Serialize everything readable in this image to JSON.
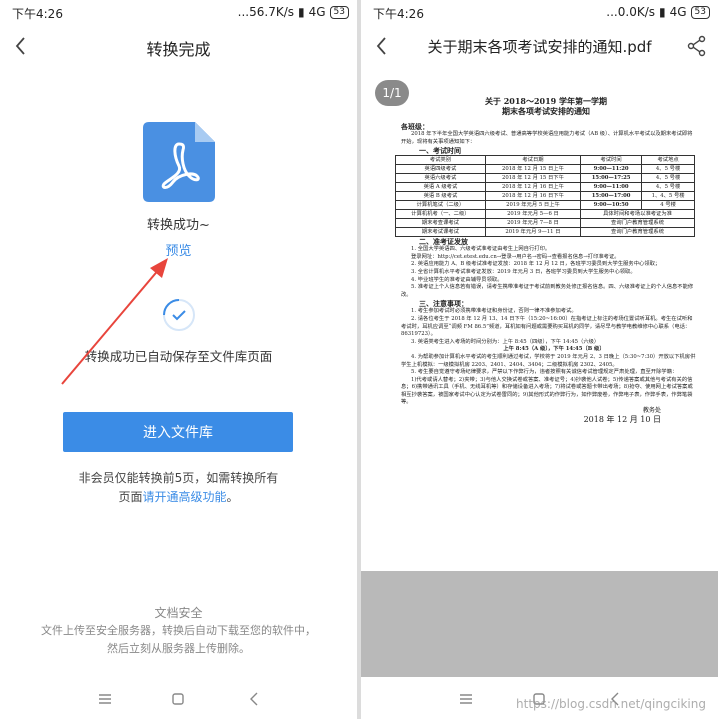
{
  "left": {
    "status": {
      "time": "下午4:26",
      "network": "...56.7K/s",
      "signal": "4G",
      "battery": "53"
    },
    "title": "转换完成",
    "success": "转换成功~",
    "preview": "预览",
    "saved": "转换成功已自动保存至文件库页面",
    "enter_button": "进入文件库",
    "member_line1": "非会员仅能转换前5页，如需转换所有",
    "member_line2_prefix": "页面",
    "member_link": "请开通高级功能",
    "member_line2_suffix": "。",
    "security_title": "文档安全",
    "security_line1": "文件上传至安全服务器，转换后自动下载至您的软件中，",
    "security_line2": "然后立刻从服务器上传删除。"
  },
  "right": {
    "status": {
      "time": "下午4:26",
      "network": "...0.0K/s",
      "signal": "4G",
      "battery": "53"
    },
    "title": "关于期末各项考试安排的通知.pdf",
    "page_indicator": "1/1",
    "watermark": "https://blog.csdn.net/qingciking",
    "doc": {
      "title1": "关于 2018～2019 学年第一学期",
      "title2": "期末各项考试安排的通知",
      "greeting": "各班级：",
      "intro": "2018 年下半年全国大学英语四六级考试、普通高等学校英语应用能力考试（AB 级）、计算机水平考试以及期末考试即将开始，现将有关事项通知如下：",
      "sec1": "一、考试时间",
      "table_headers": [
        "考试类别",
        "考试日期",
        "考试时间",
        "考试地点"
      ],
      "table_rows": [
        [
          "英语四级考试",
          "2018 年 12 月 15 日上午",
          "9:00—11:20",
          "4、5 号楼"
        ],
        [
          "英语六级考试",
          "2018 年 12 月 15 日下午",
          "15:00—17:25",
          "4、5 号楼"
        ],
        [
          "英语 A 级考试",
          "2018 年 12 月 16 日上午",
          "9:00—11:00",
          "4、5 号楼"
        ],
        [
          "英语 B 级考试",
          "2018 年 12 月 16 日下午",
          "15:00—17:00",
          "1、4、5 号楼"
        ],
        [
          "计算机笔试（二级）",
          "2019 年元月 5 日上午",
          "9:00—10:50",
          "4 号楼"
        ],
        [
          "计算机机考（一、二级）",
          "2019 年元月 5—6 日",
          "具体时间和考场以准考证为准",
          ""
        ],
        [
          "期末考查课考试",
          "2019 年元月 7—8 日",
          "查询门户教育管理系统",
          ""
        ],
        [
          "期末考试课考试",
          "2019 年元月 9—11 日",
          "查询门户教育管理系统",
          ""
        ]
      ],
      "sec2": "二、准考证发放",
      "p2_1": "1. 全国大学英语四、六级考试准考证由考生上网自行打印。",
      "p2_2": "登录网址：http://cet.etest.edu.cn→登录→用户名→密码→查看报名信息→打印准考证。",
      "p2_3": "2. 英语应用能力 A、B 级考试准考证发放：2018 年 12 月 12 日，各班学习委员到大学生服务中心领取；",
      "p2_4": "3. 全省计算机水平考试准考证发放：2019 年元月 3 日，各班学习委员到大学生服务中心领取。",
      "p2_5": "4. 毕业班学生的准考证由辅导员领取。",
      "p2_6": "5. 准考证上个人信息若有错误，请考生携带准考证于考试前到教务处修正报名信息。四、六级准考证上的个人信息不能修改。",
      "sec3": "三、注意事项：",
      "p3_1": "1. 考生参加考试时必须携带准考证和身份证，否则一律不准参加考试。",
      "p3_2": "2. 请各位考生于 2018 年 12 月 13、14 日下午（15:20~16:00）在指考证上标注的考场位置试听耳机。考生在试听和考试时，耳机应调至“调频 FM 86.5”频道，耳机如有问题或需要购买耳机的同学，请尽早与教学电教维修中心联系（电话：86319723）。",
      "p3_3": "3. 英语类考生进入考场的时间分别为：上午 8:45（四级），下午 14:45（六级）",
      "p3_3b": "上午 8:45（A 级），下午 14:45（B 级）",
      "p3_4": "4. 为帮助参加计算机水平考试的考生顺利通过考试，学校将于 2019 年元月 2、3 日晚上（5:30~7:30）开放以下机房供学生上机模拟：一级模拟机房 2203、2401、2404、3404；二级模拟机房 2302、2405。",
      "p3_5": "5. 考生要自觉遵守考场纪律要求，严禁以下作弊行为，违者按照有关诚信考试管理规定严肃处理，直至开除学籍：",
      "p3_6": "1)代考或请人替考；2)夹带；3)与他人交换试卷或答案、准考证号；4)抄袭他人试卷；5)传递答案或其他与考试有关的信息；6)携带通讯工具（手机、无线耳机等）和存储设备进入考场；7)将试卷或答题卡带出考场；8)抢夺、使用网上考试答案或相互抄袭答案，被国家考试中心认定为试卷雷同的；9)其他形式的作弊行为，如作弊废卷，作弊电子表，作弊手表，作弊笔袋等。",
      "sign1": "教务处",
      "sign2": "2018 年 12 月 10 日"
    }
  }
}
